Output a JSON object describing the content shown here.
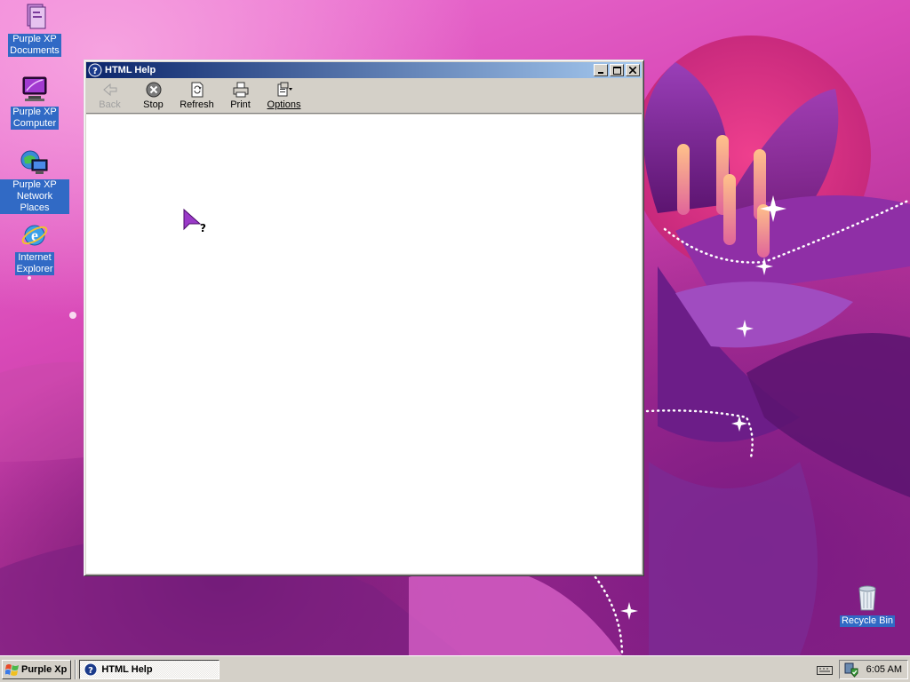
{
  "desktop": {
    "icons": [
      {
        "label_line1": "Purple XP",
        "label_line2": "Documents",
        "icon": "my-documents-icon"
      },
      {
        "label_line1": "Purple XP",
        "label_line2": "Computer",
        "icon": "my-computer-icon"
      },
      {
        "label_line1": "Purple XP",
        "label_line2": "Network Places",
        "icon": "network-places-icon"
      },
      {
        "label_line1": "Internet",
        "label_line2": "Explorer",
        "icon": "internet-explorer-icon"
      }
    ],
    "recycle_bin": {
      "label": "Recycle Bin",
      "icon": "recycle-bin-icon"
    }
  },
  "window": {
    "title": "HTML Help",
    "icon": "help-icon",
    "controls": {
      "minimize": "minimize-icon",
      "maximize": "maximize-icon",
      "close": "close-icon"
    },
    "toolbar": [
      {
        "label": "Back",
        "icon": "back-arrow-icon",
        "enabled": false
      },
      {
        "label": "Stop",
        "icon": "stop-icon",
        "enabled": true
      },
      {
        "label": "Refresh",
        "icon": "refresh-icon",
        "enabled": true
      },
      {
        "label": "Print",
        "icon": "printer-icon",
        "enabled": true
      },
      {
        "label": "Options",
        "icon": "options-icon",
        "enabled": true,
        "underline": "O"
      }
    ],
    "help_cursor_glyph": "?"
  },
  "taskbar": {
    "start_label": "Purple Xp",
    "tasks": [
      {
        "label": "HTML Help",
        "icon": "help-icon",
        "active": true
      }
    ],
    "tray": {
      "clock": "6:05 AM",
      "icons": [
        "keyboard-icon",
        "network-shield-icon"
      ]
    }
  },
  "colors": {
    "selection": "#316ac5",
    "titlebar_start": "#0a246a",
    "titlebar_end": "#a6caf0",
    "window_face": "#d4d0c8",
    "wallpaper_accent": "#b03a8e"
  }
}
